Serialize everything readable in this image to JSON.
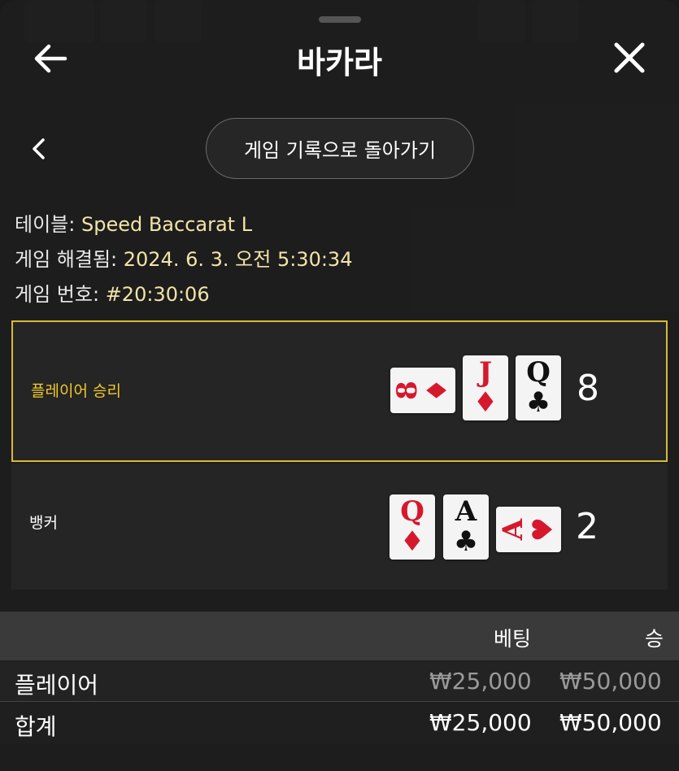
{
  "header": {
    "title": "바카라"
  },
  "nav": {
    "history_button": "게임 기록으로 돌아가기"
  },
  "info": {
    "table_label": "테이블:",
    "table_value": "Speed Baccarat L",
    "resolved_label": "게임 해결됨:",
    "resolved_value": "2024. 6. 3. 오전 5:30:34",
    "game_no_label": "게임 번호:",
    "game_no_value": "#20:30:06"
  },
  "results": {
    "player": {
      "label": "플레이어 승리",
      "score": "8",
      "cards": [
        {
          "rank": "8",
          "suit": "♦",
          "color": "red",
          "rotated": true
        },
        {
          "rank": "J",
          "suit": "♦",
          "color": "red",
          "rotated": false
        },
        {
          "rank": "Q",
          "suit": "♣",
          "color": "black",
          "rotated": false
        }
      ]
    },
    "banker": {
      "label": "뱅커",
      "score": "2",
      "cards": [
        {
          "rank": "Q",
          "suit": "♦",
          "color": "red",
          "rotated": false
        },
        {
          "rank": "A",
          "suit": "♣",
          "color": "black",
          "rotated": false
        },
        {
          "rank": "A",
          "suit": "♥",
          "color": "red",
          "rotated": true
        }
      ]
    }
  },
  "bets": {
    "col_bet": "베팅",
    "col_win": "승",
    "rows": [
      {
        "name": "플레이어",
        "bet": "₩25,000",
        "win": "₩50,000"
      },
      {
        "name": "합계",
        "bet": "₩25,000",
        "win": "₩50,000"
      }
    ]
  },
  "colors": {
    "accent": "#f1c927",
    "card_red": "#d6182d"
  }
}
